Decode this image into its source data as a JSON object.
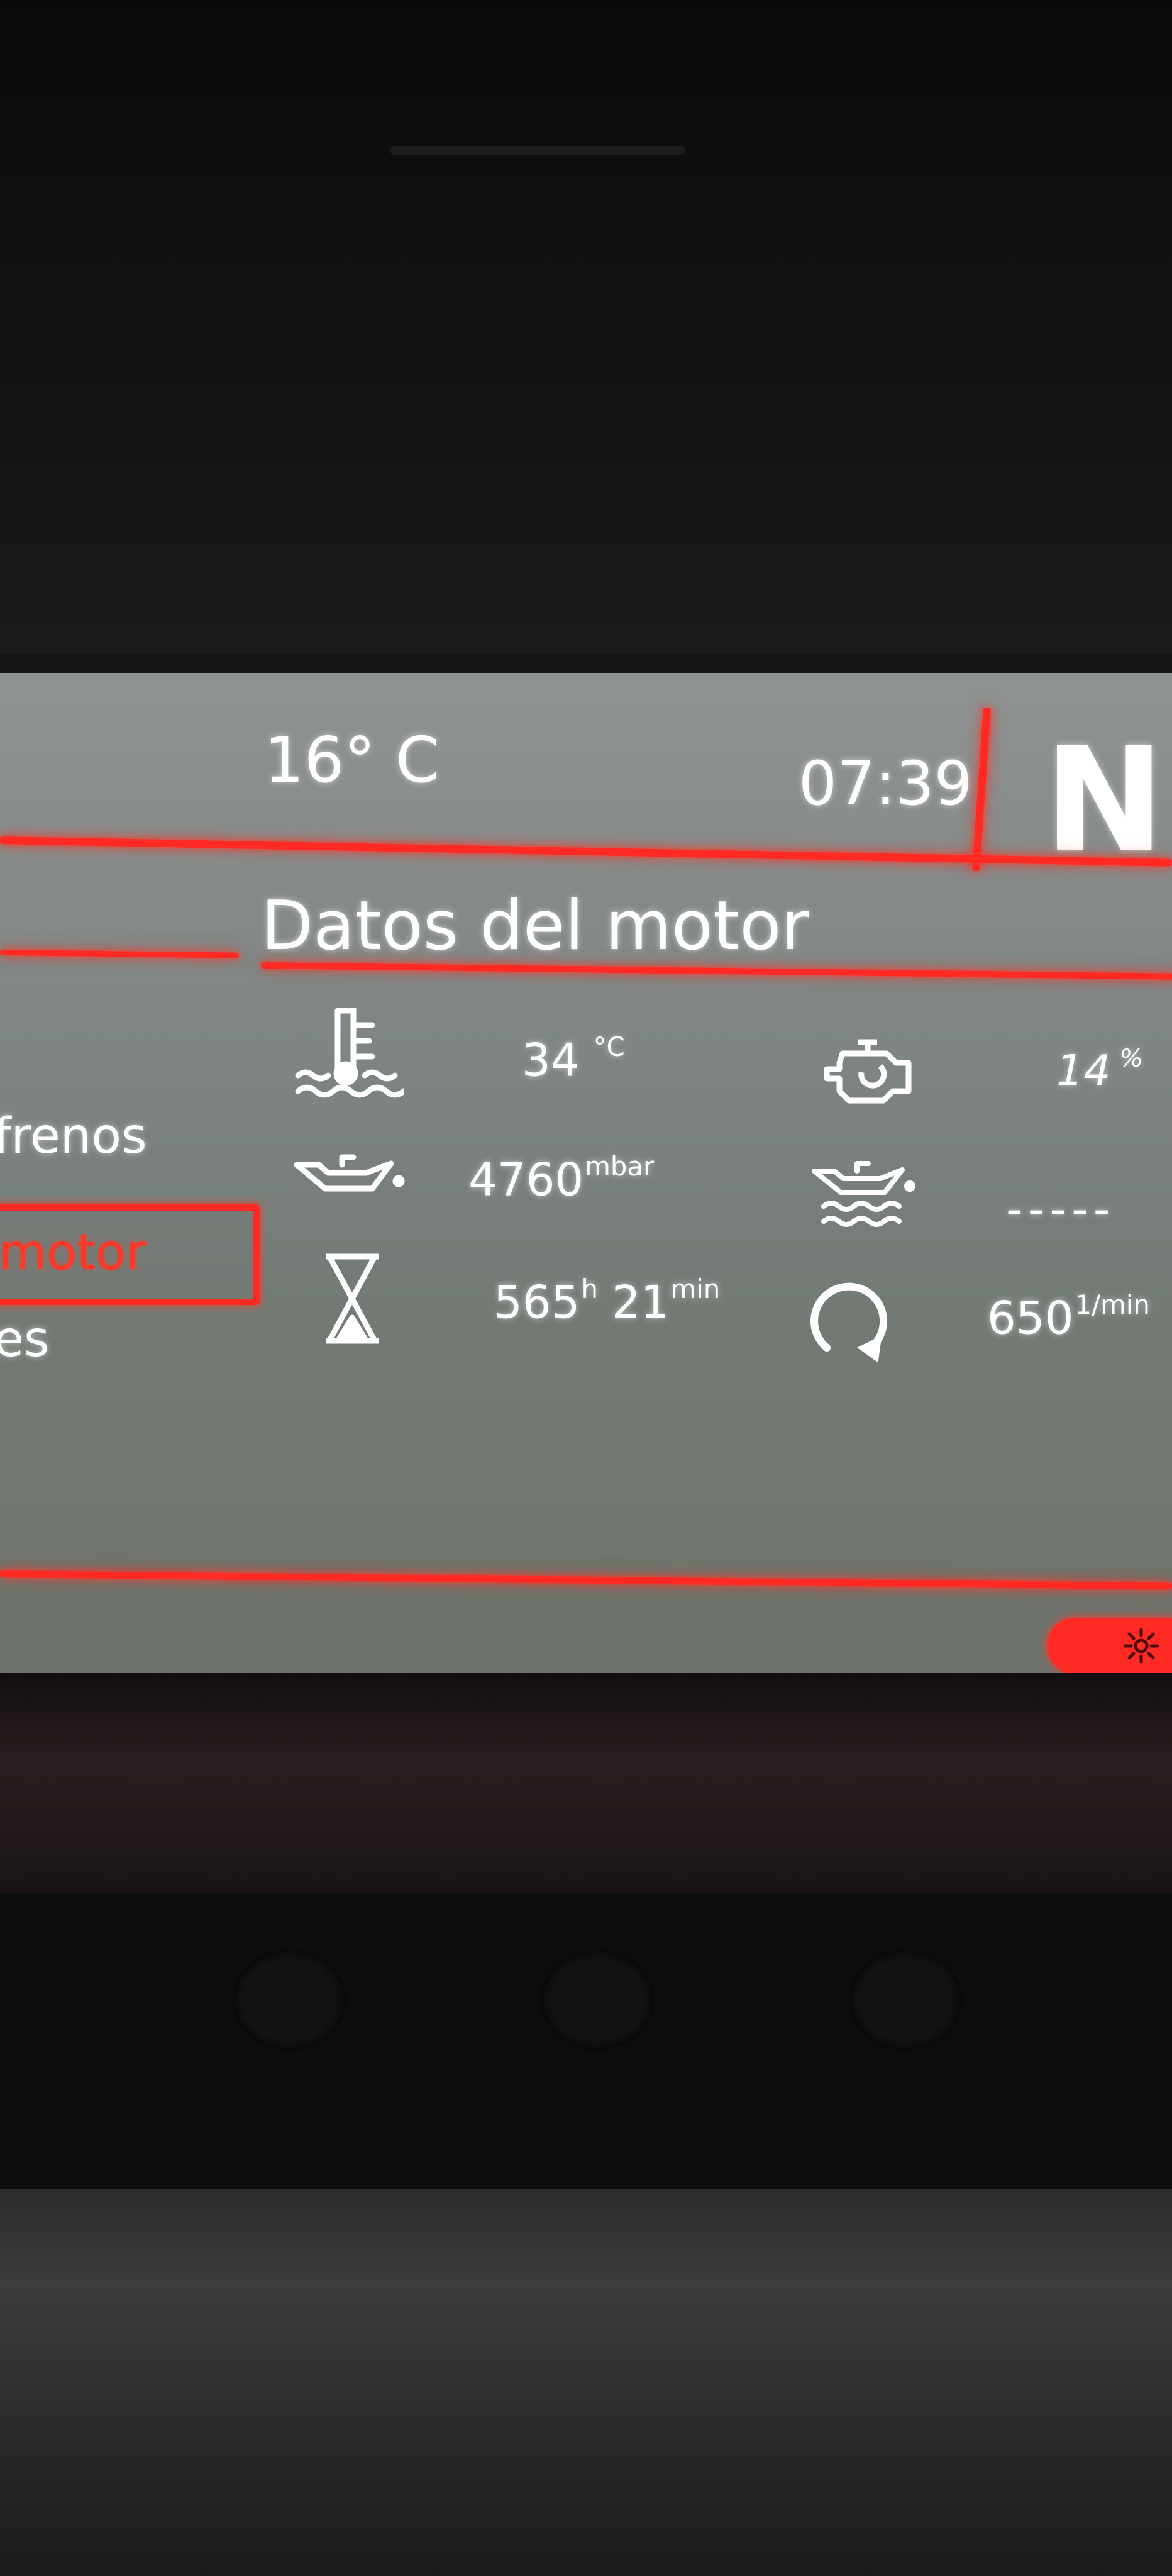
{
  "status_bar": {
    "outside_temp": "16° C",
    "clock": "07:39",
    "gear": "N"
  },
  "page_title": "Datos del motor",
  "menu": {
    "items": [
      {
        "label": "frenos",
        "selected": false
      },
      {
        "label": "motor",
        "selected": true
      },
      {
        "label": "es",
        "selected": false
      }
    ]
  },
  "engine_data": {
    "coolant_temp": {
      "value": "34",
      "unit": "°C",
      "icon": "coolant-temperature-icon"
    },
    "engine_load": {
      "value": "14",
      "unit": "%",
      "icon": "engine-icon"
    },
    "oil_pressure": {
      "value": "4760",
      "unit": "mbar",
      "icon": "oil-pressure-icon"
    },
    "oil_temp": {
      "value": "-----",
      "icon": "oil-temperature-icon"
    },
    "operating_time": {
      "hours": "565",
      "hours_unit": "h",
      "minutes": "21",
      "minutes_unit": "min",
      "icon": "hourglass-icon"
    },
    "engine_speed": {
      "value": "650",
      "unit": "1/min",
      "icon": "rpm-icon"
    }
  },
  "colors": {
    "accent": "#ff2a24",
    "screen_background": "#7f8684",
    "text": "#ffffff"
  },
  "bottom_button": {
    "icon": "brightness-icon"
  }
}
